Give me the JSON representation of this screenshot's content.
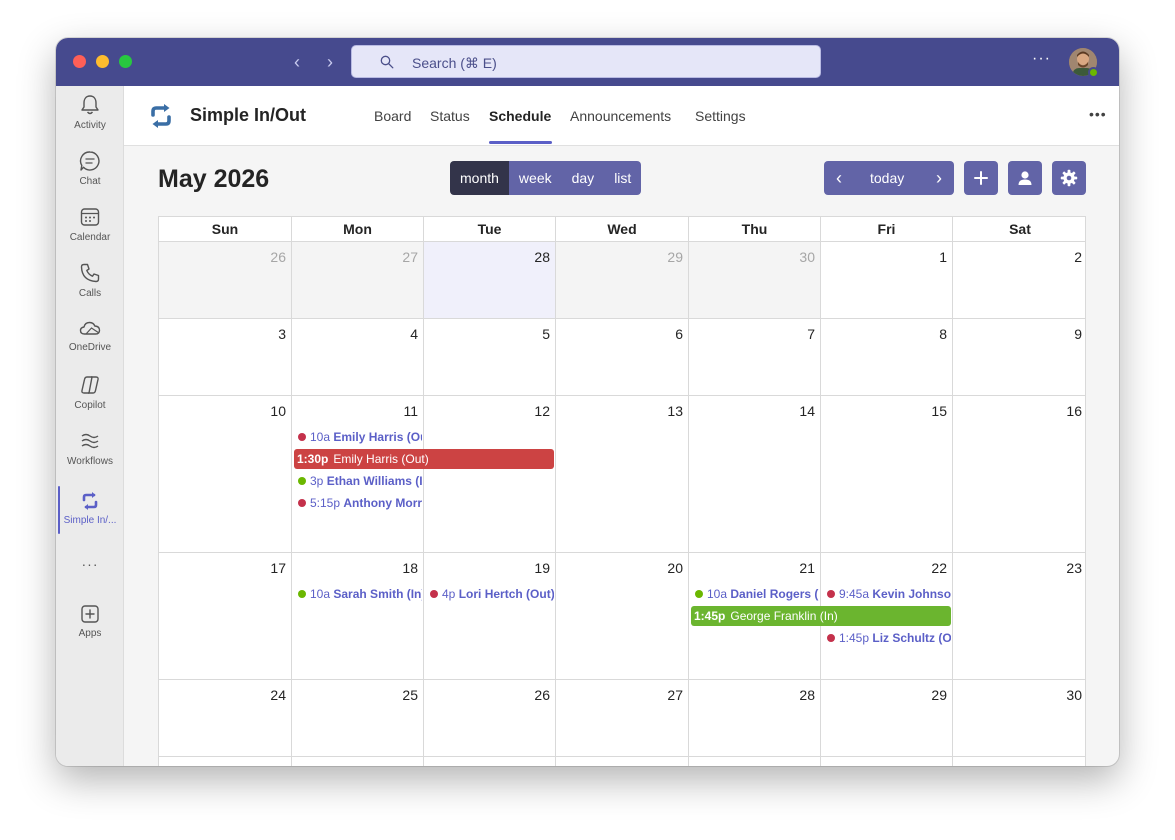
{
  "titlebar": {
    "search_placeholder": "Search (⌘ E)",
    "more_label": "···"
  },
  "rail": {
    "items": [
      {
        "label": "Activity",
        "icon": "bell-icon"
      },
      {
        "label": "Chat",
        "icon": "chat-icon"
      },
      {
        "label": "Calendar",
        "icon": "calendar-icon"
      },
      {
        "label": "Calls",
        "icon": "phone-icon"
      },
      {
        "label": "OneDrive",
        "icon": "cloud-icon"
      },
      {
        "label": "Copilot",
        "icon": "copilot-icon"
      },
      {
        "label": "Workflows",
        "icon": "workflows-icon"
      },
      {
        "label": "Simple In/...",
        "icon": "simple-in-out-icon",
        "active": true
      },
      {
        "label": "···",
        "icon": "more-icon"
      },
      {
        "label": "Apps",
        "icon": "apps-icon"
      }
    ]
  },
  "app": {
    "name": "Simple In/Out",
    "tabs": [
      "Board",
      "Status",
      "Schedule",
      "Announcements",
      "Settings"
    ],
    "active_tab": "Schedule",
    "more_label": "•••"
  },
  "calendar": {
    "title": "May 2026",
    "views": [
      "month",
      "week",
      "day",
      "list"
    ],
    "active_view": "month",
    "today_label": "today",
    "prev_label": "‹",
    "next_label": "›",
    "weekdays": [
      "Sun",
      "Mon",
      "Tue",
      "Wed",
      "Thu",
      "Fri",
      "Sat"
    ],
    "weeks": [
      [
        {
          "day": "26",
          "other": true
        },
        {
          "day": "27",
          "other": true
        },
        {
          "day": "28",
          "today": true
        },
        {
          "day": "29",
          "other": true
        },
        {
          "day": "30",
          "other": true
        },
        {
          "day": "1"
        },
        {
          "day": "2"
        }
      ],
      [
        {
          "day": "3"
        },
        {
          "day": "4"
        },
        {
          "day": "5"
        },
        {
          "day": "6"
        },
        {
          "day": "7"
        },
        {
          "day": "8"
        },
        {
          "day": "9"
        }
      ],
      [
        {
          "day": "10"
        },
        {
          "day": "11"
        },
        {
          "day": "12"
        },
        {
          "day": "13"
        },
        {
          "day": "14"
        },
        {
          "day": "15"
        },
        {
          "day": "16"
        }
      ],
      [
        {
          "day": "17"
        },
        {
          "day": "18"
        },
        {
          "day": "19"
        },
        {
          "day": "20"
        },
        {
          "day": "21"
        },
        {
          "day": "22"
        },
        {
          "day": "23"
        }
      ],
      [
        {
          "day": "24"
        },
        {
          "day": "25"
        },
        {
          "day": "26"
        },
        {
          "day": "27"
        },
        {
          "day": "28"
        },
        {
          "day": "29"
        },
        {
          "day": "30"
        }
      ]
    ],
    "events": [
      {
        "week": 2,
        "col": 1,
        "slot": 0,
        "time": "10a",
        "title": "Emily Harris (Out)",
        "status": "out"
      },
      {
        "week": 2,
        "col": 1,
        "slot": 1,
        "span": 2,
        "time": "1:30p",
        "title": "Emily Harris (Out)",
        "status": "out",
        "bar": true
      },
      {
        "week": 2,
        "col": 1,
        "slot": 2,
        "time": "3p",
        "title": "Ethan Williams (In)",
        "status": "in"
      },
      {
        "week": 2,
        "col": 1,
        "slot": 3,
        "time": "5:15p",
        "title": "Anthony Morris (Out)",
        "status": "out"
      },
      {
        "week": 3,
        "col": 1,
        "slot": 0,
        "time": "10a",
        "title": "Sarah Smith (In)",
        "status": "in"
      },
      {
        "week": 3,
        "col": 2,
        "slot": 0,
        "time": "4p",
        "title": "Lori Hertch (Out)",
        "status": "out"
      },
      {
        "week": 3,
        "col": 4,
        "slot": 0,
        "time": "10a",
        "title": "Daniel Rogers (In)",
        "status": "in"
      },
      {
        "week": 3,
        "col": 5,
        "slot": 0,
        "time": "9:45a",
        "title": "Kevin Johnson (Out)",
        "status": "out"
      },
      {
        "week": 3,
        "col": 4,
        "slot": 1,
        "span": 2,
        "time": "1:45p",
        "title": "George Franklin (In)",
        "status": "in",
        "bar": true
      },
      {
        "week": 3,
        "col": 5,
        "slot": 2,
        "time": "1:45p",
        "title": "Liz Schultz (Out)",
        "status": "out"
      }
    ]
  },
  "colors": {
    "accent": "#6264a7",
    "titlebar": "#464a8e",
    "status_in": "#6bb700",
    "status_out": "#c4314b"
  }
}
